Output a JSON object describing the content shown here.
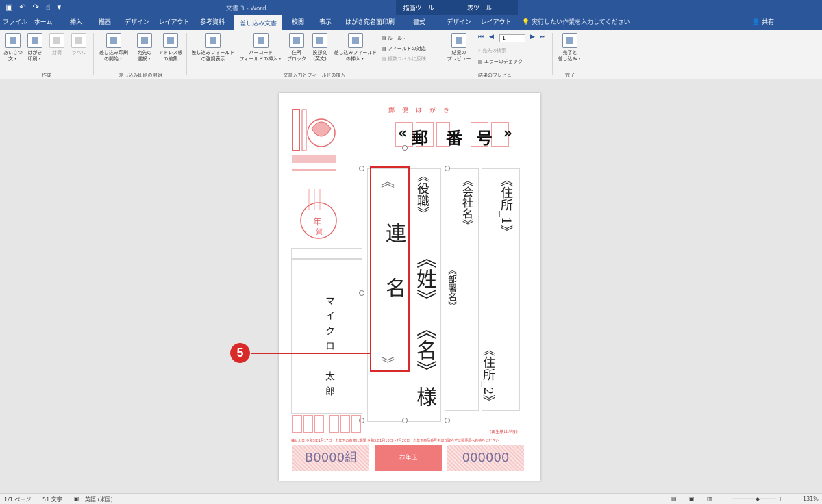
{
  "window": {
    "doc_title": "文書 3 - Word",
    "contextual_labels": [
      "描画ツール",
      "表ツール"
    ]
  },
  "quick_access": {
    "save_icon": "save-icon",
    "undo_icon": "undo-icon",
    "redo_icon": "redo-icon",
    "touch_icon": "touch-mode-icon",
    "customize": "▾"
  },
  "tabs": [
    "ファイル",
    "ホーム",
    "挿入",
    "描画",
    "デザイン",
    "レイアウト",
    "参考資料",
    "差し込み文書",
    "校閲",
    "表示",
    "はがき宛名面印刷",
    "書式",
    "デザイン",
    "レイアウト"
  ],
  "active_tab_index": 7,
  "tell_me": "実行したい作業を入力してください",
  "share": "共有",
  "ribbon": {
    "create": {
      "label": "作成",
      "greeting": "あいさつ\n文・",
      "postcard_print": "はがき\n印刷・",
      "envelope": "封筒",
      "labels": "ラベル"
    },
    "start_merge": {
      "label": "差し込み印刷の開始",
      "start": "差し込み印刷\nの開始・",
      "select_recipients": "宛先の\n選択・",
      "edit_list": "アドレス帳\nの編集"
    },
    "write_insert": {
      "label": "文章入力とフィールドの挿入",
      "highlight_fields": "差し込みフィールド\nの強調表示",
      "barcode": "バーコード\nフィールドの挿入・",
      "address_block": "住所\nブロック",
      "greeting_line": "挨拶文\n(英文)",
      "insert_field": "差し込みフィールド\nの挿入・",
      "rules": "ルール・",
      "match_fields": "フィールドの対応",
      "update_labels": "複数ラベルに反映"
    },
    "preview": {
      "label": "結果のプレビュー",
      "preview_results": "結果の\nプレビュー",
      "record": "1",
      "find_recipient": "宛先の検索",
      "check_errors": "エラーのチェック"
    },
    "finish": {
      "label": "完了",
      "finish_merge": "完了と\n差し込み・"
    }
  },
  "postcard": {
    "header": "郵便はがき",
    "postal_code": [
      "«",
      "郵",
      "番",
      "号",
      "»"
    ],
    "renmei": [
      "︽",
      "連",
      "名",
      "︾"
    ],
    "title_field": "《役職》",
    "surname_field": "《姓》",
    "given_field": "《名》",
    "sama": "様",
    "company_field": "《会社名》",
    "department_field": "《部署名》",
    "address1_field": "《住所_1》",
    "address2_field": "《住所_2》",
    "sender_name": "マイクロ　太郎",
    "lottery_left": "B0000組",
    "lottery_mid": "お年玉",
    "lottery_right": "000000",
    "corner_note": "(再生紙はがき)",
    "bottom_note": "抽せん日 令和3年1月17日　お年玉のお渡し期間 令和3年1月18日〜7月20日　お年玉商品番号を切り取らずに郵便局へお持ちください"
  },
  "callout": {
    "number": "5"
  },
  "status": {
    "page": "1/1 ページ",
    "words": "51 文字",
    "language": "英語 (米国)",
    "zoom": "131%"
  },
  "colors": {
    "ribbon_blue": "#2b579a",
    "postcard_red": "#e04040",
    "callout_red": "#d92a2a"
  }
}
